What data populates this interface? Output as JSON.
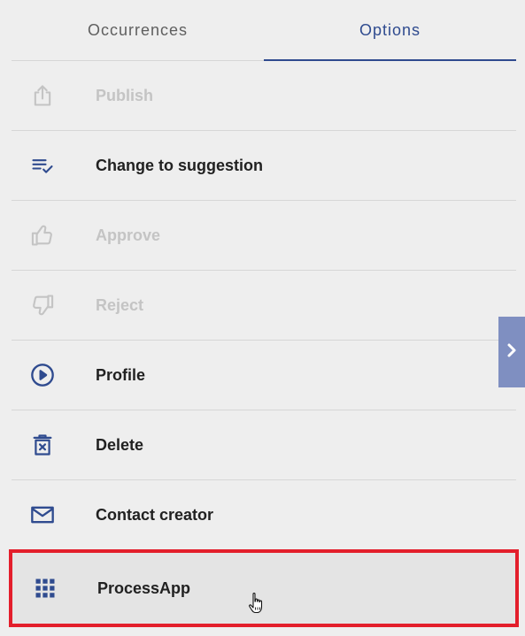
{
  "tabs": [
    {
      "label": "Occurrences",
      "active": false
    },
    {
      "label": "Options",
      "active": true
    }
  ],
  "menu": {
    "items": [
      {
        "label": "Publish",
        "icon": "share-upload-icon",
        "enabled": false
      },
      {
        "label": "Change to suggestion",
        "icon": "list-check-icon",
        "enabled": true
      },
      {
        "label": "Approve",
        "icon": "thumbs-up-icon",
        "enabled": false
      },
      {
        "label": "Reject",
        "icon": "thumbs-down-icon",
        "enabled": false
      },
      {
        "label": "Profile",
        "icon": "play-circle-icon",
        "enabled": true
      },
      {
        "label": "Delete",
        "icon": "trash-x-icon",
        "enabled": true
      },
      {
        "label": "Contact creator",
        "icon": "envelope-icon",
        "enabled": true
      },
      {
        "label": "ProcessApp",
        "icon": "apps-grid-icon",
        "enabled": true,
        "highlighted": true
      }
    ]
  },
  "side_toggle": {
    "icon": "chevron-right-icon"
  },
  "colors": {
    "accent": "#2f4b8f",
    "icon_enabled": "#2f4b8f",
    "icon_disabled": "#c4c4c4",
    "highlight_border": "#e31e2b",
    "side_toggle_bg": "#7f8fc1"
  }
}
